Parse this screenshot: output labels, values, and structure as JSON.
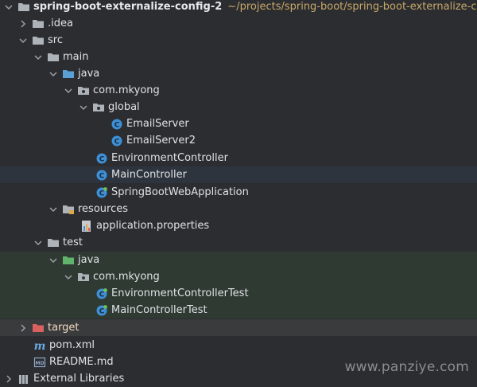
{
  "project": {
    "name": "spring-boot-externalize-config-2",
    "path": "~/projects/spring-boot/spring-boot-externalize-co"
  },
  "tree": {
    "idea": ".idea",
    "src": "src",
    "main": "main",
    "main_java": "java",
    "pkg_main": "com.mkyong",
    "global": "global",
    "email_server": "EmailServer",
    "email_server2": "EmailServer2",
    "environment_controller": "EnvironmentController",
    "main_controller": "MainController",
    "app_class": "SpringBootWebApplication",
    "resources": "resources",
    "app_properties": "application.properties",
    "test": "test",
    "test_java": "java",
    "pkg_test": "com.mkyong",
    "env_controller_test": "EnvironmentControllerTest",
    "main_controller_test": "MainControllerTest",
    "target": "target",
    "pom": "pom.xml",
    "readme": "README.md",
    "external_libraries": "External Libraries"
  },
  "watermark": "www.panziye.com",
  "colors": {
    "background": "#2b2d30",
    "selected_row": "#2e343d",
    "test_zone": "#2f3a33",
    "folder_gray": "#aeb3ba",
    "folder_blue": "#5a9fd6",
    "folder_green": "#5fb36a",
    "folder_red": "#d96060",
    "class_icon": "#3d8fd6"
  }
}
